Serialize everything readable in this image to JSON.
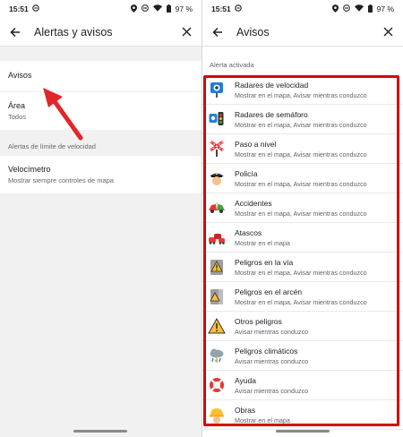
{
  "left_screen": {
    "status": {
      "time": "15:51",
      "battery": "97 %"
    },
    "appbar": {
      "title": "Alertas y avisos"
    },
    "rows": [
      {
        "title": "Avisos",
        "subtitle": ""
      },
      {
        "title": "Área",
        "subtitle": "Todos"
      }
    ],
    "section_label": "Alertas de límite de velocidad",
    "speed_row": {
      "title": "Velocímetro",
      "subtitle": "Mostrar siempre controles de mapa"
    }
  },
  "right_screen": {
    "status": {
      "time": "15:51",
      "battery": "97 %"
    },
    "appbar": {
      "title": "Avisos"
    },
    "section_label": "Alerta activada",
    "items": [
      {
        "title": "Radares de velocidad",
        "subtitle": "Mostrar en el mapa, Avisar mientras conduzco",
        "icon": "speed-camera-icon"
      },
      {
        "title": "Radares de semáforo",
        "subtitle": "Mostrar en el mapa, Avisar mientras conduzco",
        "icon": "traffic-light-camera-icon"
      },
      {
        "title": "Paso a nivel",
        "subtitle": "Mostrar en el mapa, Avisar mientras conduzco",
        "icon": "railway-crossing-icon"
      },
      {
        "title": "Policía",
        "subtitle": "Mostrar en el mapa, Avisar mientras conduzco",
        "icon": "police-icon"
      },
      {
        "title": "Accidentes",
        "subtitle": "Mostrar en el mapa, Avisar mientras conduzco",
        "icon": "accident-icon"
      },
      {
        "title": "Atascos",
        "subtitle": "Mostrar en el mapa",
        "icon": "traffic-jam-icon"
      },
      {
        "title": "Peligros en la vía",
        "subtitle": "Mostrar en el mapa, Avisar mientras conduzco",
        "icon": "road-hazard-icon"
      },
      {
        "title": "Peligros en el arcén",
        "subtitle": "Mostrar en el mapa, Avisar mientras conduzco",
        "icon": "shoulder-hazard-icon"
      },
      {
        "title": "Otros peligros",
        "subtitle": "Avisar mientras conduzco",
        "icon": "warning-icon"
      },
      {
        "title": "Peligros climáticos",
        "subtitle": "Avisar mientras conduzco",
        "icon": "weather-icon"
      },
      {
        "title": "Ayuda",
        "subtitle": "Avisar mientras conduzco",
        "icon": "help-lifebuoy-icon"
      },
      {
        "title": "Obras",
        "subtitle": "Mostrar en el mapa",
        "icon": "construction-icon"
      }
    ]
  },
  "colors": {
    "highlight": "#d90000",
    "arrow": "#e3262b"
  }
}
